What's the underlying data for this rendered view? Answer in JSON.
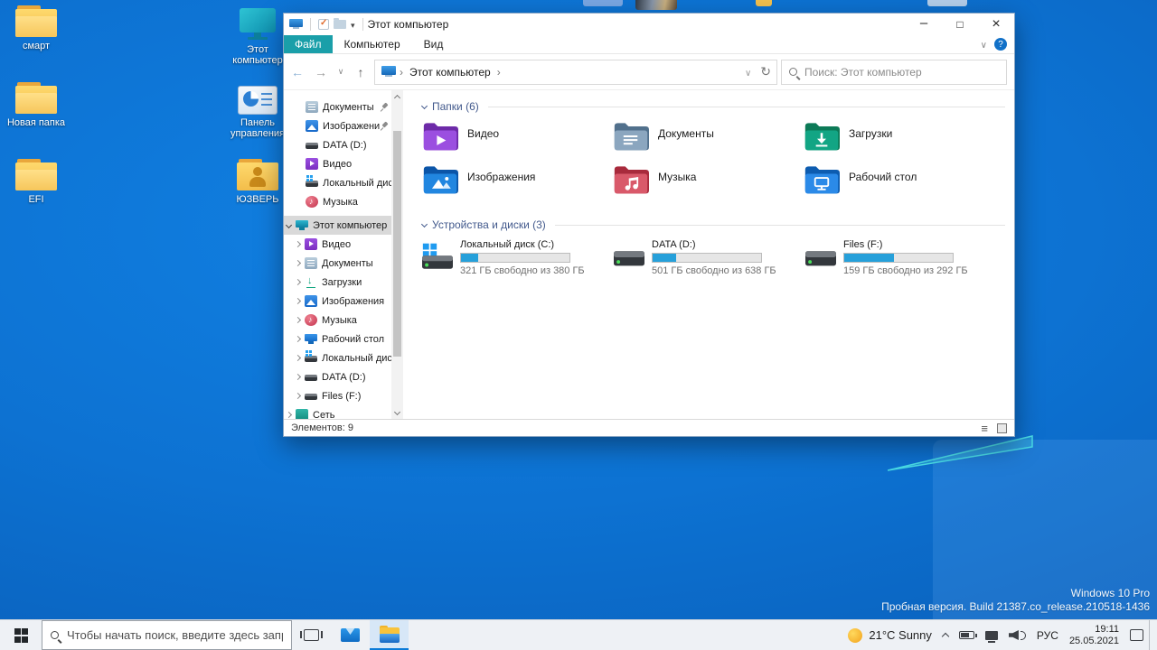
{
  "colors": {
    "accent_teal": "#1a9fa9",
    "accent_blue": "#0078d7",
    "progress_fill": "#26a0da",
    "desktop_blue": "#0d72d2"
  },
  "desktop": {
    "icons_col1": [
      {
        "label": "смарт"
      },
      {
        "label": "Новая папка"
      },
      {
        "label": "EFI"
      }
    ],
    "icons_col2": [
      {
        "label": "Этот компьютер"
      },
      {
        "label": "Панель управления"
      },
      {
        "label": "ЮЗВЕРЬ"
      }
    ],
    "watermark": {
      "line1": "Windows 10 Pro",
      "line2": "Пробная версия. Build 21387.co_release.210518-1436"
    }
  },
  "window": {
    "title": "Этот компьютер",
    "tabs": [
      {
        "label": "Файл"
      },
      {
        "label": "Компьютер"
      },
      {
        "label": "Вид"
      }
    ],
    "breadcrumb_root": "Этот компьютер",
    "search_placeholder": "Поиск: Этот компьютер",
    "sidebar": {
      "quick": [
        {
          "label": "Документы"
        },
        {
          "label": "Изображени"
        },
        {
          "label": "DATA (D:)"
        },
        {
          "label": "Видео"
        },
        {
          "label": "Локальный дис"
        },
        {
          "label": "Музыка"
        }
      ],
      "root": "Этот компьютер",
      "children": [
        "Видео",
        "Документы",
        "Загрузки",
        "Изображения",
        "Музыка",
        "Рабочий стол",
        "Локальный диск",
        "DATA (D:)",
        "Files (F:)"
      ],
      "network": "Сеть"
    },
    "groups": [
      {
        "label": "Папки (6)"
      },
      {
        "label": "Устройства и диски (3)"
      }
    ],
    "folders": [
      {
        "label": "Видео"
      },
      {
        "label": "Документы"
      },
      {
        "label": "Загрузки"
      },
      {
        "label": "Изображения"
      },
      {
        "label": "Музыка"
      },
      {
        "label": "Рабочий стол"
      }
    ],
    "drives": [
      {
        "label": "Локальный диск (C:)",
        "free": "321 ГБ свободно из 380 ГБ",
        "used_pct": 16
      },
      {
        "label": "DATA (D:)",
        "free": "501 ГБ свободно из 638 ГБ",
        "used_pct": 22
      },
      {
        "label": "Files (F:)",
        "free": "159 ГБ свободно из 292 ГБ",
        "used_pct": 46
      }
    ],
    "status": "Элементов: 9"
  },
  "taskbar": {
    "search_placeholder": "Чтобы начать поиск, введите здесь запрос",
    "weather": "21°C Sunny",
    "lang": "РУС",
    "time": "19:11",
    "date": "25.05.2021"
  }
}
